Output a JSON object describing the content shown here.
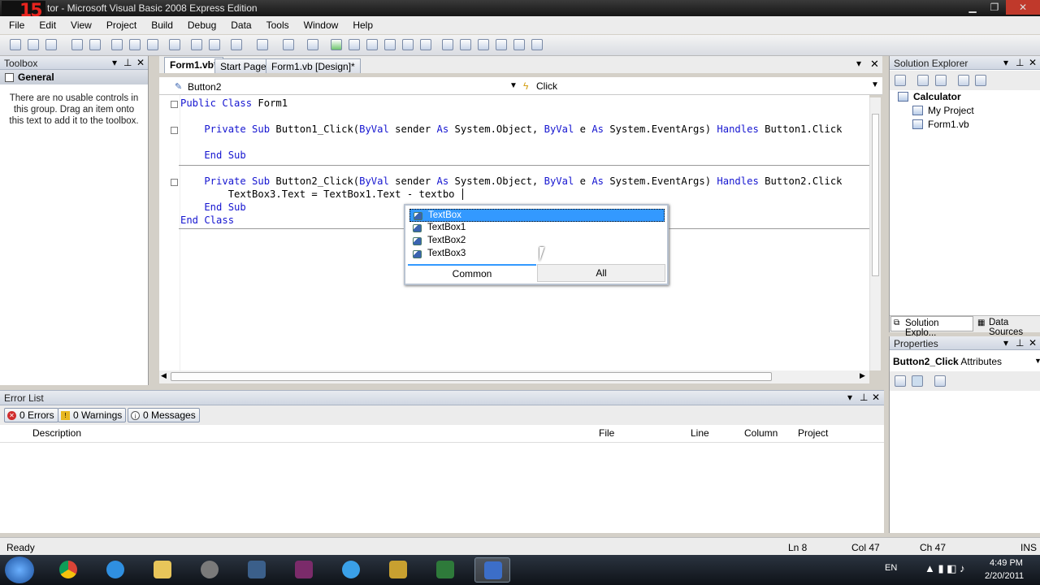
{
  "window": {
    "title": "tor - Microsoft Visual Basic 2008 Express Edition"
  },
  "menu": [
    "File",
    "Edit",
    "View",
    "Project",
    "Build",
    "Debug",
    "Data",
    "Tools",
    "Window",
    "Help"
  ],
  "toolbox": {
    "title": "Toolbox",
    "group": "General",
    "message": "There are no usable controls in this group. Drag an item onto this text to add it to the toolbox."
  },
  "doc_tabs": [
    "Form1.vb*",
    "Start Page",
    "Form1.vb [Design]*"
  ],
  "nav": {
    "object": "Button2",
    "event": "Click"
  },
  "code_lines": [
    [
      {
        "t": "Public Class",
        "k": 1
      },
      {
        "t": " Form1",
        "k": 0
      }
    ],
    [
      {
        "t": "",
        "k": 0
      }
    ],
    [
      {
        "t": "    Private Sub",
        "k": 1
      },
      {
        "t": " Button1_Click(",
        "k": 0
      },
      {
        "t": "ByVal",
        "k": 1
      },
      {
        "t": " sender ",
        "k": 0
      },
      {
        "t": "As",
        "k": 1
      },
      {
        "t": " System.Object, ",
        "k": 0
      },
      {
        "t": "ByVal",
        "k": 1
      },
      {
        "t": " e ",
        "k": 0
      },
      {
        "t": "As",
        "k": 1
      },
      {
        "t": " System.EventArgs) ",
        "k": 0
      },
      {
        "t": "Handles",
        "k": 1
      },
      {
        "t": " Button1.Click",
        "k": 0
      }
    ],
    [
      {
        "t": "",
        "k": 0
      }
    ],
    [
      {
        "t": "    End Sub",
        "k": 1
      }
    ],
    [
      {
        "t": "",
        "k": 0
      }
    ],
    [
      {
        "t": "    Private Sub",
        "k": 1
      },
      {
        "t": " Button2_Click(",
        "k": 0
      },
      {
        "t": "ByVal",
        "k": 1
      },
      {
        "t": " sender ",
        "k": 0
      },
      {
        "t": "As",
        "k": 1
      },
      {
        "t": " System.Object, ",
        "k": 0
      },
      {
        "t": "ByVal",
        "k": 1
      },
      {
        "t": " e ",
        "k": 0
      },
      {
        "t": "As",
        "k": 1
      },
      {
        "t": " System.EventArgs) ",
        "k": 0
      },
      {
        "t": "Handles",
        "k": 1
      },
      {
        "t": " Button2.Click",
        "k": 0
      }
    ],
    [
      {
        "t": "        TextBox3.Text = TextBox1.Text - textbo",
        "k": 0
      }
    ],
    [
      {
        "t": "    End Sub",
        "k": 1
      }
    ],
    [
      {
        "t": "End Class",
        "k": 1
      }
    ]
  ],
  "intellisense": {
    "items": [
      "TextBox",
      "TextBox1",
      "TextBox2",
      "TextBox3"
    ],
    "selected": 0,
    "tabs": [
      "Common",
      "All"
    ]
  },
  "error_list": {
    "title": "Error List",
    "buttons": [
      "0 Errors",
      "0 Warnings",
      "0 Messages"
    ],
    "columns": [
      "Description",
      "File",
      "Line",
      "Column",
      "Project"
    ]
  },
  "solution_explorer": {
    "title": "Solution Explorer",
    "project": "Calculator",
    "items": [
      "My Project",
      "Form1.vb"
    ],
    "tabs": [
      "Solution Explo...",
      "Data Sources"
    ]
  },
  "properties": {
    "title": "Properties",
    "object": "Button2_Click",
    "type": "Attributes"
  },
  "status": {
    "text": "Ready",
    "ln": "Ln 8",
    "col": "Col 47",
    "ch": "Ch 47",
    "mode": "INS"
  },
  "tray": {
    "lang": "EN",
    "time": "4:49 PM",
    "date": "2/20/2011"
  }
}
